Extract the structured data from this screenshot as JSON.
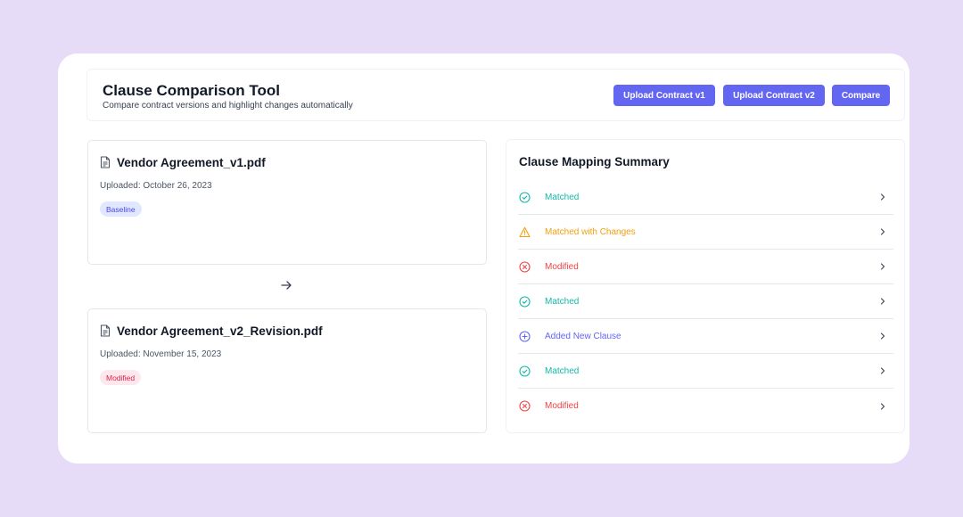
{
  "header": {
    "title": "Clause Comparison Tool",
    "subtitle": "Compare contract versions and highlight changes automatically",
    "buttons": {
      "upload_v1": "Upload Contract v1",
      "upload_v2": "Upload Contract v2",
      "compare": "Compare"
    }
  },
  "documents": [
    {
      "name": "Vendor Agreement_v1.pdf",
      "uploaded": "Uploaded: October 26, 2023",
      "badge": "Baseline"
    },
    {
      "name": "Vendor Agreement_v2_Revision.pdf",
      "uploaded": "Uploaded: November 15, 2023",
      "badge": "Modified"
    }
  ],
  "summary": {
    "title": "Clause Mapping Summary",
    "rows": [
      {
        "status": "Matched",
        "icon": "check-circle-icon"
      },
      {
        "status": "Matched with Changes",
        "icon": "warning-triangle-icon"
      },
      {
        "status": "Modified",
        "icon": "x-circle-icon"
      },
      {
        "status": "Matched",
        "icon": "check-circle-icon"
      },
      {
        "status": "Added New Clause",
        "icon": "plus-circle-icon"
      },
      {
        "status": "Matched",
        "icon": "check-circle-icon"
      },
      {
        "status": "Modified",
        "icon": "x-circle-icon"
      }
    ]
  },
  "colors": {
    "accent": "#6366f1",
    "matched": "#14b8a6",
    "changes": "#f59e0b",
    "modified": "#ef4444",
    "added": "#6366f1",
    "baseline_badge_bg": "#e0e7ff",
    "baseline_badge_text": "#4f46e5",
    "modified_badge_bg": "#fde8ee",
    "modified_badge_text": "#e11d48"
  }
}
